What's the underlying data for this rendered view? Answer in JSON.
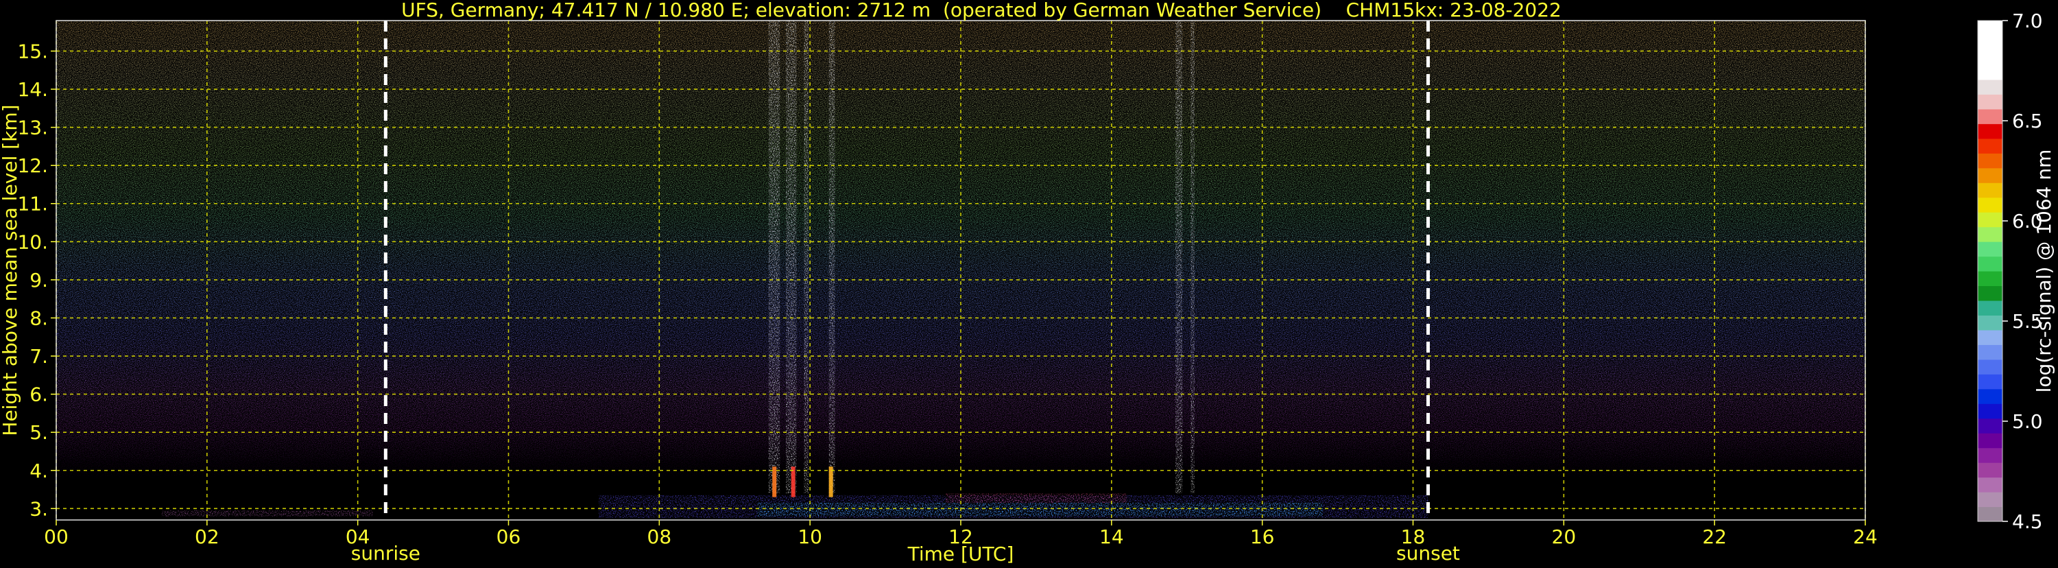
{
  "chart_data": {
    "type": "heatmap",
    "title": "UFS, Germany; 47.417 N / 10.980 E; elevation: 2712 m  (operated by German Weather Service)    CHM15kx: 23-08-2022",
    "xlabel": "Time [UTC]",
    "ylabel": "Height above mean sea level [km]",
    "xlim": [
      0,
      24
    ],
    "ylim": [
      2.7,
      15.8
    ],
    "x_ticks": [
      "00",
      "02",
      "04",
      "06",
      "08",
      "10",
      "12",
      "14",
      "16",
      "18",
      "20",
      "22",
      "24"
    ],
    "y_ticks": [
      "3.",
      "4.",
      "5.",
      "6.",
      "7.",
      "8.",
      "9.",
      "10.",
      "11.",
      "12.",
      "13.",
      "14.",
      "15."
    ],
    "grid": true,
    "annotations": [
      {
        "label": "sunrise",
        "x": 4.37
      },
      {
        "label": "sunset",
        "x": 18.2
      }
    ],
    "colorbar": {
      "label": "log(rc-signal) @ 1064 nm",
      "range": [
        4.5,
        7.0
      ],
      "ticks": [
        "4.5",
        "5.0",
        "5.5",
        "6.0",
        "6.5",
        "7.0"
      ],
      "colors": [
        "#9b8a9b",
        "#b08fb0",
        "#b06fb0",
        "#a040a0",
        "#8a20a0",
        "#6a009a",
        "#4400b0",
        "#1010d0",
        "#0030e0",
        "#3050f0",
        "#5070f0",
        "#7090f0",
        "#90b0f0",
        "#60c0b0",
        "#30b090",
        "#109020",
        "#20b030",
        "#40d060",
        "#60e080",
        "#a0f060",
        "#d0f030",
        "#f0e000",
        "#f0c000",
        "#f09000",
        "#f06000",
        "#f03000",
        "#e00000",
        "#f08080",
        "#f0c0c0",
        "#e8e0e0",
        "#ffffff",
        "#ffffff",
        "#ffffff",
        "#ffffff"
      ]
    },
    "colors": {
      "text": "#ffff33",
      "grid": "#dddd00",
      "background": "#000000",
      "colorbar_text": "#ffffff"
    }
  }
}
